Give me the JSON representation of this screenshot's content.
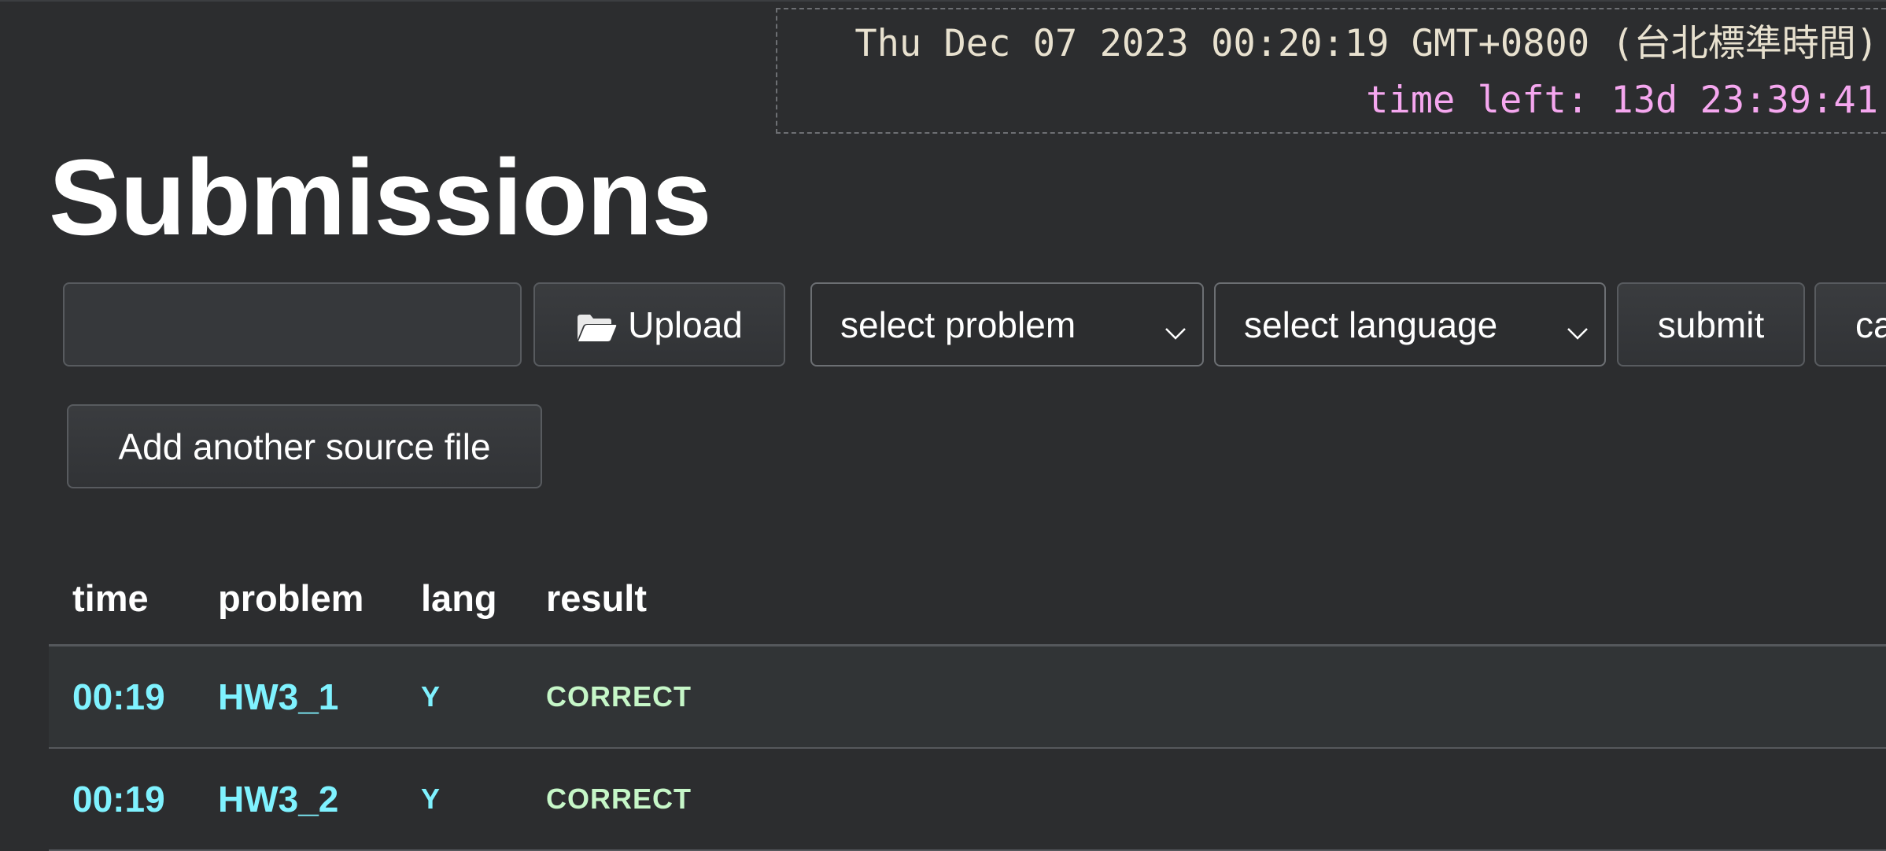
{
  "clock": {
    "current_time": "Thu Dec 07 2023 00:20:19 GMT+0800 (台北標準時間)",
    "time_left": "time left: 13d 23:39:41"
  },
  "page_title": "Submissions",
  "form": {
    "file_input_value": "",
    "upload_label": "Upload",
    "problem_select": "select problem",
    "language_select": "select language",
    "submit_label": "submit",
    "cancel_label": "ca",
    "add_source_label": "Add another source file"
  },
  "table": {
    "headers": [
      "time",
      "problem",
      "lang",
      "result"
    ],
    "rows": [
      {
        "time": "00:19",
        "problem": "HW3_1",
        "lang": "Y",
        "result": "CORRECT"
      },
      {
        "time": "00:19",
        "problem": "HW3_2",
        "lang": "Y",
        "result": "CORRECT"
      }
    ]
  },
  "colors": {
    "background": "#2c2d2f",
    "link_cyan": "#7ff2ff",
    "correct_green": "#c6f7c8",
    "time_left_pink": "#f5a7ef"
  },
  "icons": {
    "upload": "folder-icon",
    "select": "chevron-down-icon"
  }
}
